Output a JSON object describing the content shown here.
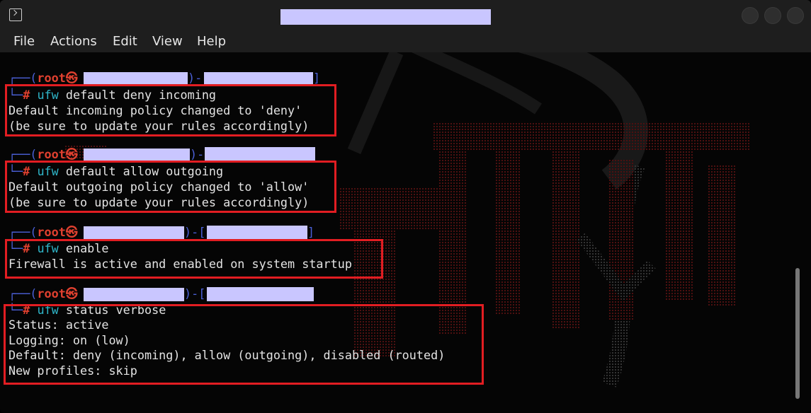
{
  "window": {
    "title_redacted": true,
    "app_icon": "terminal-icon",
    "controls": [
      "minimize-button",
      "maximize-button",
      "close-button"
    ]
  },
  "menu": {
    "file": "File",
    "actions": "Actions",
    "edit": "Edit",
    "view": "View",
    "help": "Help"
  },
  "prompt": {
    "user": "root",
    "symbol": "㉿",
    "hash": "#"
  },
  "blocks": [
    {
      "command": "ufw",
      "args": "default deny incoming",
      "output": [
        "Default incoming policy changed to 'deny'",
        "(be sure to update your rules accordingly)"
      ]
    },
    {
      "command": "ufw",
      "args": "default allow outgoing",
      "output": [
        "Default outgoing policy changed to 'allow'",
        "(be sure to update your rules accordingly)"
      ]
    },
    {
      "command": "ufw",
      "args": "enable",
      "output": [
        "Firewall is active and enabled on system startup"
      ]
    },
    {
      "command": "ufw",
      "args": "status verbose",
      "output": [
        "Status: active",
        "Logging: on (low)",
        "Default: deny (incoming), allow (outgoing), disabled (routed)",
        "New profiles: skip"
      ]
    }
  ],
  "colors": {
    "highlight_box": "#e21d22",
    "prompt_root": "#e0402f",
    "prompt_corner": "#4a5fd6",
    "command": "#2fb5c8",
    "redaction": "#c9c6ff",
    "terminal_bg": "#050505"
  }
}
